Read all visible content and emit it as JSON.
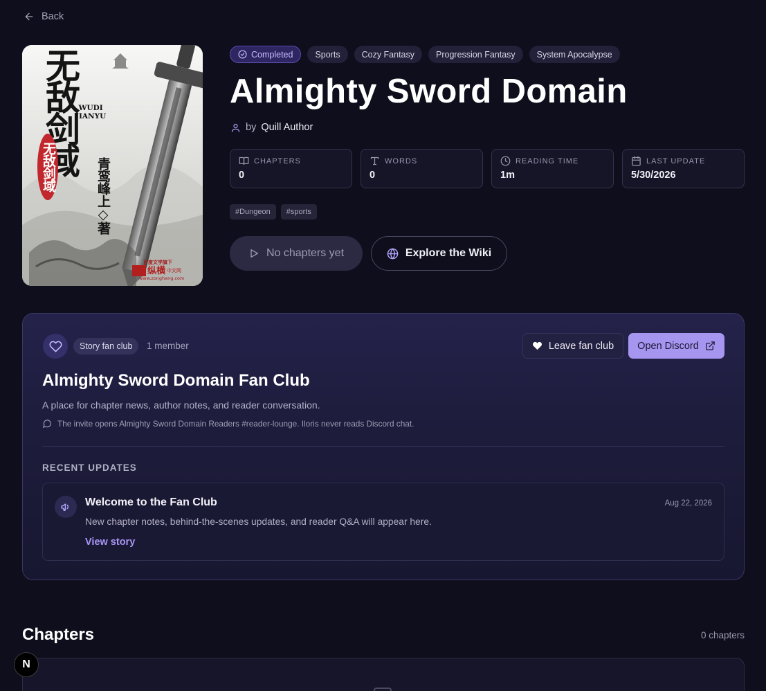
{
  "nav": {
    "back_label": "Back"
  },
  "cover": {
    "title_cn": "无敌剑域",
    "small_title_cn": "无敌剑域",
    "roman_line1": "WUDI",
    "roman_line2": "JIANYU",
    "author_cn": "青鸾峰上◇著",
    "publisher_top": "百度文学旗下",
    "publisher_name": "纵横",
    "publisher_sub": "中文网",
    "publisher_url": "www.zongheng.com"
  },
  "tags": {
    "status": "Completed",
    "genres": [
      "Sports",
      "Cozy Fantasy",
      "Progression Fantasy",
      "System Apocalypse"
    ]
  },
  "story": {
    "title": "Almighty Sword Domain",
    "by_label": "by",
    "author": "Quill Author"
  },
  "stats": {
    "chapters": {
      "label": "CHAPTERS",
      "value": "0",
      "icon": "book-open-icon"
    },
    "words": {
      "label": "WORDS",
      "value": "0",
      "icon": "type-icon"
    },
    "reading_time": {
      "label": "READING TIME",
      "value": "1m",
      "icon": "clock-icon"
    },
    "last_update": {
      "label": "LAST UPDATE",
      "value": "5/30/2026",
      "icon": "calendar-icon"
    }
  },
  "hashtags": [
    "#Dungeon",
    "#sports"
  ],
  "actions": {
    "start_label": "No chapters yet",
    "wiki_label": "Explore the Wiki"
  },
  "fan_club": {
    "badge": "Story fan club",
    "members": "1 member",
    "leave_label": "Leave fan club",
    "discord_label": "Open Discord",
    "title": "Almighty Sword Domain Fan Club",
    "description": "A place for chapter news, author notes, and reader conversation.",
    "note": "The invite opens Almighty Sword Domain Readers #reader-lounge. Iloris never reads Discord chat.",
    "recent_heading": "RECENT UPDATES",
    "update": {
      "title": "Welcome to the Fan Club",
      "date": "Aug 22, 2026",
      "body": "New chapter notes, behind-the-scenes updates, and reader Q&A will appear here.",
      "link": "View story"
    }
  },
  "chapters": {
    "title": "Chapters",
    "count": "0 chapters"
  },
  "dev_badge": {
    "label": "N"
  },
  "colors": {
    "background": "#0f0e1c",
    "accent": "#a796ef",
    "status_chip": "#2e2660"
  }
}
